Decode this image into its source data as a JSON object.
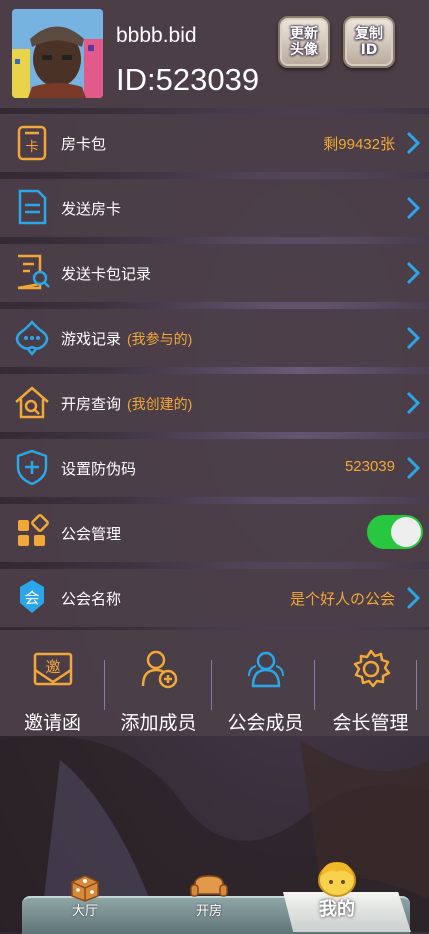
{
  "user": {
    "name": "bbbb.bid",
    "id_text": "ID:523039"
  },
  "header_buttons": {
    "update_avatar": "更新\n头像",
    "copy_id": "复制\nID"
  },
  "menu": [
    {
      "label": "房卡包",
      "sub": "",
      "value": "剩99432张",
      "icon": "room-card-icon"
    },
    {
      "label": "发送房卡",
      "sub": "",
      "value": "",
      "icon": "document-icon"
    },
    {
      "label": "发送卡包记录",
      "sub": "",
      "value": "",
      "icon": "record-search-icon"
    },
    {
      "label": "游戏记录",
      "sub": "(我参与的)",
      "value": "",
      "icon": "game-chat-icon"
    },
    {
      "label": "开房查询",
      "sub": "(我创建的)",
      "value": "",
      "icon": "house-search-icon"
    },
    {
      "label": "设置防伪码",
      "sub": "",
      "value": "523039",
      "icon": "shield-plus-icon"
    },
    {
      "label": "公会管理",
      "sub": "",
      "value": "",
      "icon": "grid-apps-icon",
      "toggle_on": true
    },
    {
      "label": "公会名称",
      "sub": "",
      "value": "是个好人の公会",
      "icon": "guild-badge-icon"
    }
  ],
  "actions": [
    {
      "label": "邀请函",
      "icon": "invitation-envelope-icon",
      "icon_text": "邀"
    },
    {
      "label": "添加成员",
      "icon": "add-member-icon"
    },
    {
      "label": "公会成员",
      "icon": "members-icon"
    },
    {
      "label": "会长管理",
      "icon": "gear-icon"
    }
  ],
  "tabs": [
    {
      "label": "大厅",
      "icon": "dice-icon"
    },
    {
      "label": "开房",
      "icon": "sofa-icon"
    },
    {
      "label": "我的",
      "icon": "profile-icon",
      "selected": true
    }
  ],
  "colors": {
    "accent": "#f2a838",
    "icon_blue": "#2aa7e8",
    "toggle_on": "#27c83f",
    "row_bg": "#4b3e46"
  }
}
